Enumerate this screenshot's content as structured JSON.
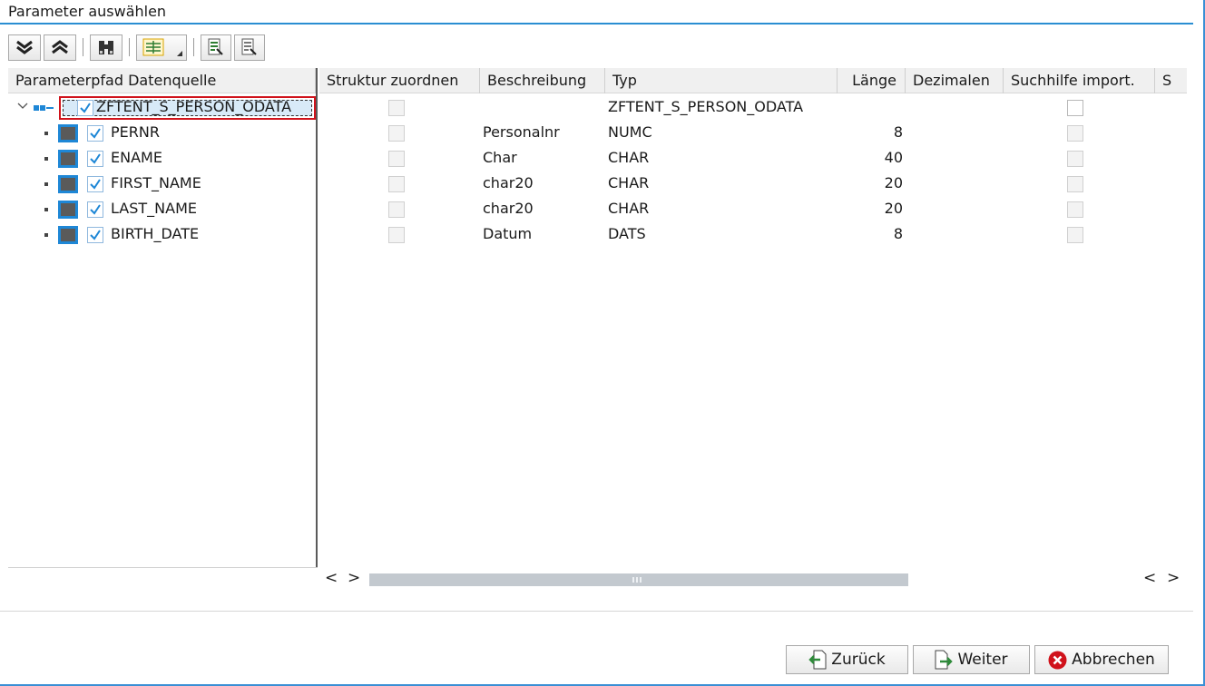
{
  "dialog": {
    "title": "Parameter auswählen"
  },
  "toolbar": {
    "buttons": [
      {
        "name": "expand-all-icon"
      },
      {
        "name": "collapse-all-icon"
      },
      {
        "name": "find-icon"
      },
      {
        "name": "layout-icon"
      },
      {
        "name": "select-all-icon"
      },
      {
        "name": "deselect-all-icon"
      }
    ]
  },
  "tree": {
    "header": "Parameterpfad Datenquelle",
    "root": {
      "label": "ZFTENT_S_PERSON_ODATA",
      "checked": true
    },
    "fields": [
      {
        "label": "PERNR",
        "checked": true
      },
      {
        "label": "ENAME",
        "checked": true
      },
      {
        "label": "FIRST_NAME",
        "checked": true
      },
      {
        "label": "LAST_NAME",
        "checked": true
      },
      {
        "label": "BIRTH_DATE",
        "checked": true
      }
    ]
  },
  "grid": {
    "headers": {
      "struktur": "Struktur zuordnen",
      "beschreibung": "Beschreibung",
      "typ": "Typ",
      "laenge": "Länge",
      "dezimalen": "Dezimalen",
      "suchhilfe": "Suchhilfe import.",
      "s": "S"
    },
    "rows": [
      {
        "beschreibung": "",
        "typ": "ZFTENT_S_PERSON_ODATA",
        "laenge": ""
      },
      {
        "beschreibung": "Personalnr",
        "typ": "NUMC",
        "laenge": "8"
      },
      {
        "beschreibung": "Char",
        "typ": "CHAR",
        "laenge": "40"
      },
      {
        "beschreibung": "char20",
        "typ": "CHAR",
        "laenge": "20"
      },
      {
        "beschreibung": "char20",
        "typ": "CHAR",
        "laenge": "20"
      },
      {
        "beschreibung": "Datum",
        "typ": "DATS",
        "laenge": "8"
      }
    ]
  },
  "scroll": {
    "left": "<",
    "right": ">"
  },
  "footer": {
    "back_label": "Zurück",
    "next_label": "Weiter",
    "cancel_label": "Abbrechen"
  },
  "colors": {
    "accent": "#2a8ed2",
    "check": "#1e87d6",
    "cancel": "#d0121b"
  }
}
